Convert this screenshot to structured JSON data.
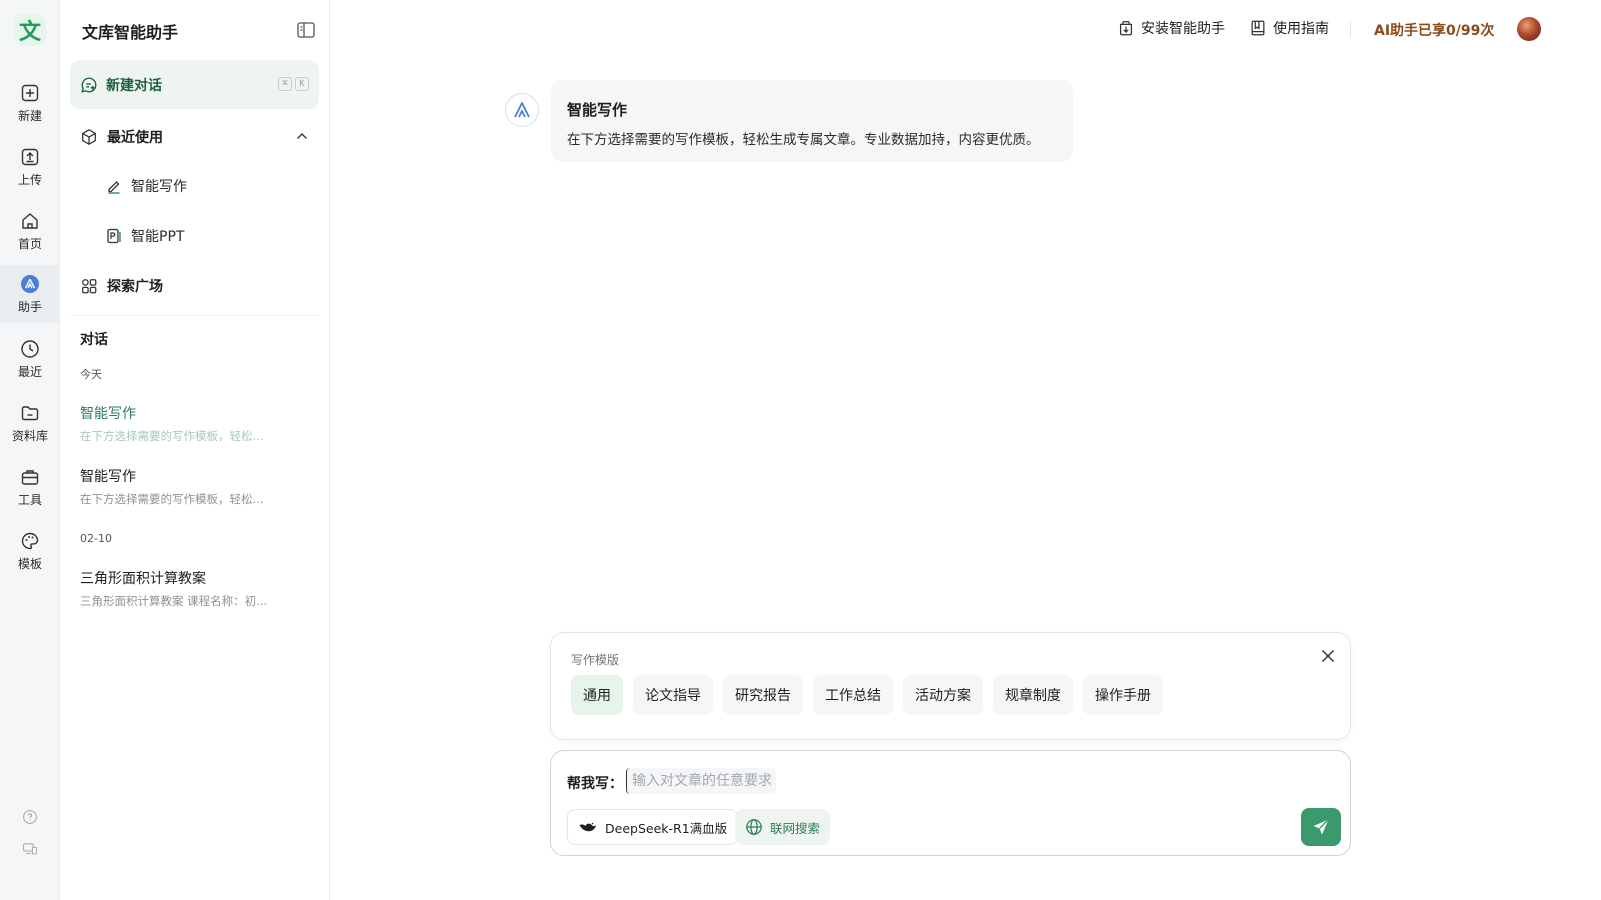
{
  "rail": {
    "logo_char": "文",
    "items": [
      {
        "label": "新建",
        "icon": "plus-square-icon"
      },
      {
        "label": "上传",
        "icon": "upload-icon"
      },
      {
        "label": "首页",
        "icon": "home-icon"
      },
      {
        "label": "助手",
        "icon": "assistant-icon",
        "active": true
      },
      {
        "label": "最近",
        "icon": "clock-icon"
      },
      {
        "label": "资料库",
        "icon": "folder-icon"
      },
      {
        "label": "工具",
        "icon": "toolbox-icon"
      },
      {
        "label": "模板",
        "icon": "palette-icon"
      }
    ]
  },
  "sidebar": {
    "title": "文库智能助手",
    "new_chat": {
      "label": "新建对话",
      "kbd": [
        "⌘",
        "K"
      ]
    },
    "recent": {
      "label": "最近使用",
      "items": [
        {
          "label": "智能写作",
          "icon": "pen-icon"
        },
        {
          "label": "智能PPT",
          "icon": "ppt-icon"
        }
      ]
    },
    "explore": {
      "label": "探索广场"
    },
    "conversations": {
      "label": "对话",
      "groups": [
        {
          "label": "今天",
          "items": [
            {
              "title": "智能写作",
              "snippet": "在下方选择需要的写作模板，轻松...",
              "active": true
            },
            {
              "title": "智能写作",
              "snippet": "在下方选择需要的写作模板，轻松..."
            }
          ]
        },
        {
          "label": "02-10",
          "items": [
            {
              "title": "三角形面积计算教案",
              "snippet": "三角形面积计算教案 课程名称：初..."
            }
          ]
        }
      ]
    }
  },
  "header": {
    "install_label": "安装智能助手",
    "guide_label": "使用指南",
    "quota_label": "AI助手已享0/99次"
  },
  "message": {
    "title": "智能写作",
    "text": "在下方选择需要的写作模板，轻松生成专属文章。专业数据加持，内容更优质。"
  },
  "templates": {
    "label": "写作模版",
    "chips": [
      "通用",
      "论文指导",
      "研究报告",
      "工作总结",
      "活动方案",
      "规章制度",
      "操作手册"
    ],
    "active_index": 0
  },
  "composer": {
    "prefix": "帮我写：",
    "placeholder": "输入对文章的任意要求",
    "model_label": "DeepSeek-R1满血版",
    "web_search_label": "联网搜索"
  },
  "colors": {
    "brand_green": "#3a9a6c",
    "quota_brown": "#8a4b1a",
    "assistant_blue": "#4a7fd6"
  }
}
